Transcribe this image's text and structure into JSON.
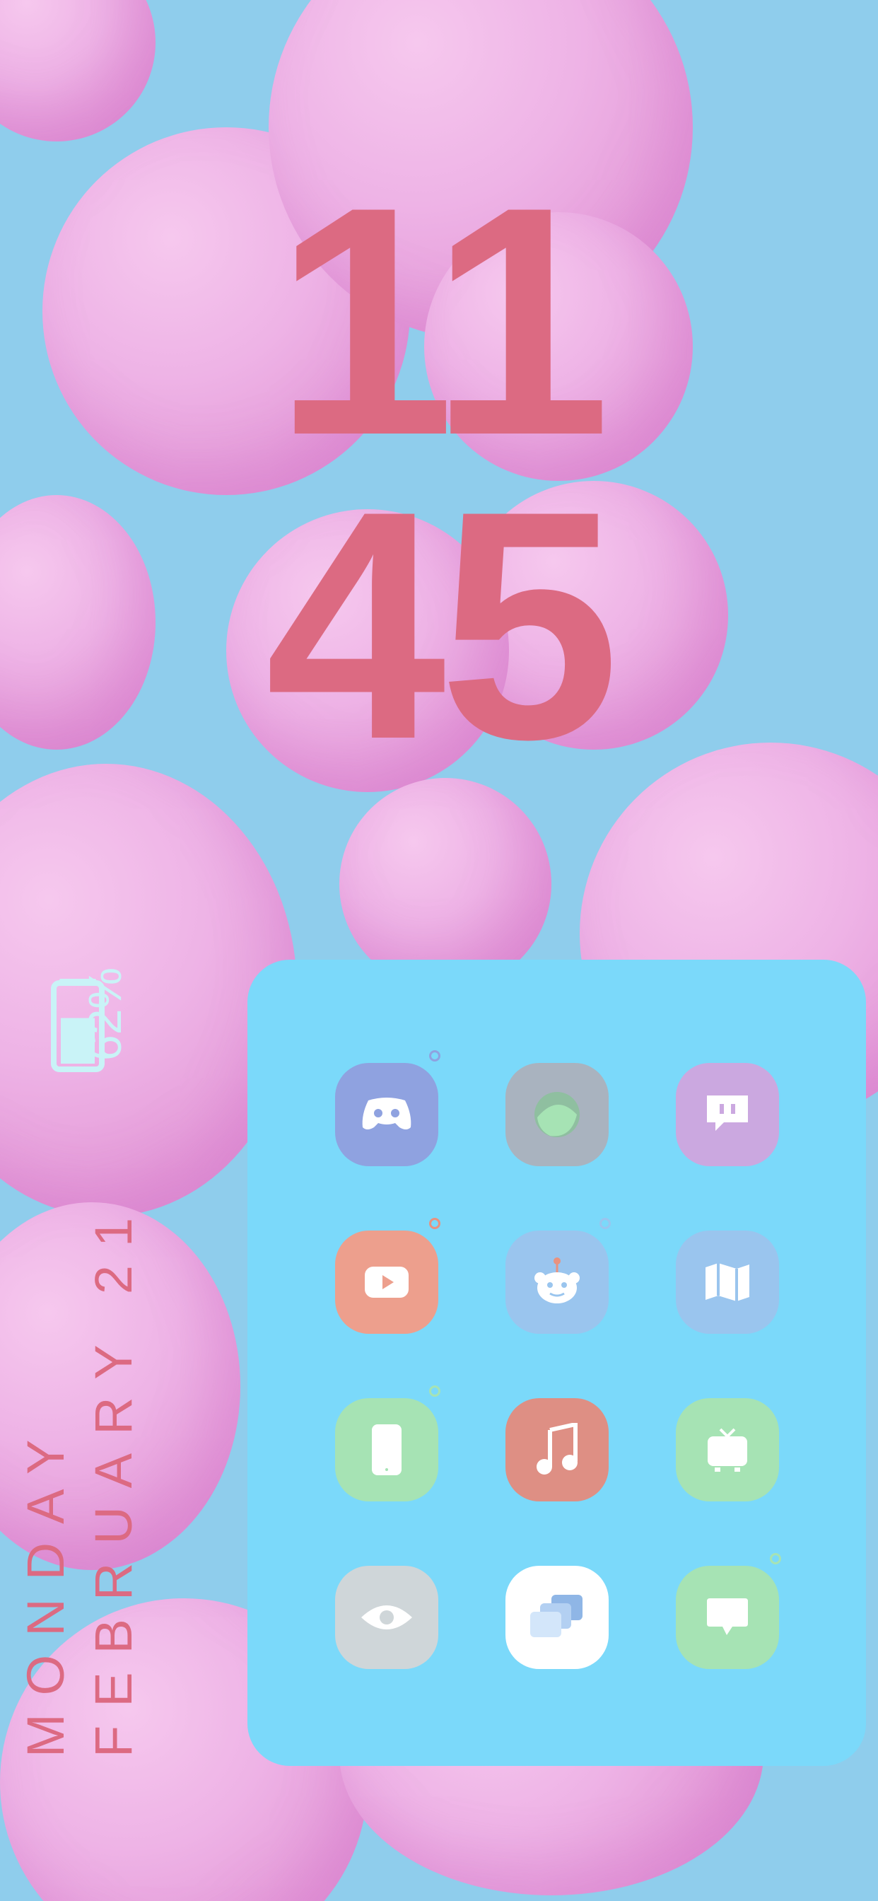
{
  "clock": {
    "hour": "11",
    "minute": "45"
  },
  "battery": {
    "percent": "62%",
    "level": 0.62,
    "icon": "battery-icon"
  },
  "date": {
    "weekday": "MONDAY",
    "month_day": "FEBRUARY 21"
  },
  "colors": {
    "accent": "#dc6a82",
    "dock": "#7bd9fa",
    "battery": "#c9f3f7"
  },
  "dock": {
    "apps": [
      {
        "name": "discord",
        "icon": "gamepad-icon",
        "bg": "#8fa2e0",
        "badge": true,
        "badge_color": "#8fa2e0"
      },
      {
        "name": "phone-ball",
        "icon": "orb-icon",
        "bg": "#a9b3bf",
        "badge": false
      },
      {
        "name": "twitch",
        "icon": "chat-face-icon",
        "bg": "#cba8e0",
        "badge": false
      },
      {
        "name": "youtube",
        "icon": "play-icon",
        "bg": "#ed9f8d",
        "badge": true,
        "badge_color": "#e9927f"
      },
      {
        "name": "reddit",
        "icon": "reddit-icon",
        "bg": "#9ac5ee",
        "badge": true,
        "badge_color": "#9ac5ee"
      },
      {
        "name": "maps",
        "icon": "map-icon",
        "bg": "#9ac5ee",
        "badge": false
      },
      {
        "name": "phone",
        "icon": "phone-icon",
        "bg": "#a6e3b4",
        "badge": true,
        "badge_color": "#a6e3b4"
      },
      {
        "name": "music",
        "icon": "music-note-icon",
        "bg": "#de8f84",
        "badge": false
      },
      {
        "name": "tv",
        "icon": "tv-icon",
        "bg": "#a6e3b4",
        "badge": false
      },
      {
        "name": "eye",
        "icon": "eye-icon",
        "bg": "#cfd6d9",
        "badge": false
      },
      {
        "name": "windows",
        "icon": "windows-icon",
        "bg": "#ffffff",
        "badge": false
      },
      {
        "name": "messages",
        "icon": "message-icon",
        "bg": "#a6e3b4",
        "badge": true,
        "badge_color": "#a6e3b4"
      }
    ]
  }
}
